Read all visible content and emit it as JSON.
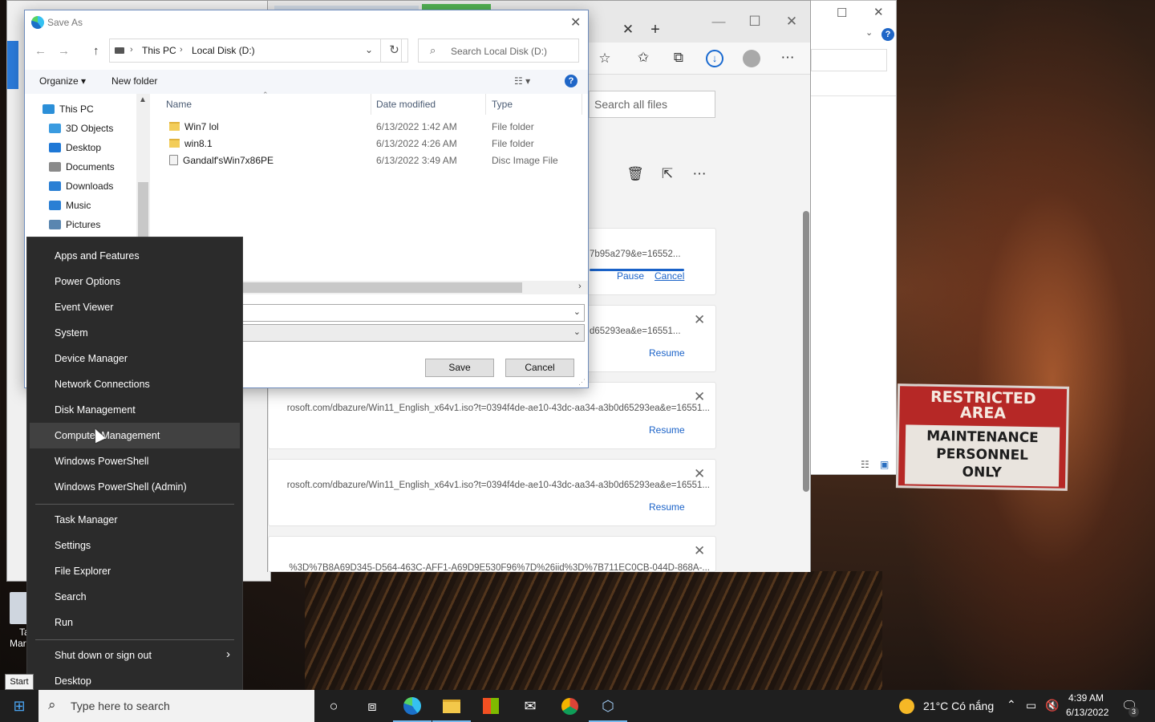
{
  "dialog": {
    "title": "Save As",
    "breadcrumb": [
      "This PC",
      "Local Disk (D:)"
    ],
    "search_placeholder": "Search Local Disk (D:)",
    "organize_label": "Organize",
    "new_folder_label": "New folder",
    "nav_items": [
      {
        "label": "This PC",
        "icon": "pc-icon",
        "color": "#2b8fd8"
      },
      {
        "label": "3D Objects",
        "icon": "cube-icon",
        "color": "#3a9be0"
      },
      {
        "label": "Desktop",
        "icon": "desktop-icon",
        "color": "#1e78d6"
      },
      {
        "label": "Documents",
        "icon": "document-icon",
        "color": "#8a8a8a"
      },
      {
        "label": "Downloads",
        "icon": "download-icon",
        "color": "#2a7fd4"
      },
      {
        "label": "Music",
        "icon": "music-icon",
        "color": "#2a7fd4"
      },
      {
        "label": "Pictures",
        "icon": "pictures-icon",
        "color": "#5a86b0"
      }
    ],
    "columns": [
      "Name",
      "Date modified",
      "Type"
    ],
    "files": [
      {
        "name": "Win7 lol",
        "date": "6/13/2022 1:42 AM",
        "type": "File folder",
        "kind": "folder"
      },
      {
        "name": "win8.1",
        "date": "6/13/2022 4:26 AM",
        "type": "File folder",
        "kind": "folder"
      },
      {
        "name": "Gandalf'sWin7x86PE",
        "date": "6/13/2022 3:49 AM",
        "type": "Disc Image File",
        "kind": "iso"
      }
    ],
    "save_label": "Save",
    "cancel_label": "Cancel"
  },
  "context_menu": {
    "group1": [
      "Apps and Features",
      "Power Options",
      "Event Viewer",
      "System",
      "Device Manager",
      "Network Connections",
      "Disk Management",
      "Computer Management",
      "Windows PowerShell",
      "Windows PowerShell (Admin)"
    ],
    "group2": [
      "Task Manager",
      "Settings",
      "File Explorer",
      "Search",
      "Run"
    ],
    "group3": [
      "Shut down or sign out",
      "Desktop"
    ],
    "hovered": "Computer Management"
  },
  "edge": {
    "search_all_files_placeholder": "Search all files",
    "downloads": [
      {
        "url": "7b95a279&e=16552...",
        "actions": [
          "Pause",
          "Cancel"
        ]
      },
      {
        "url": "d65293ea&e=16551...",
        "actions": [
          "Resume"
        ]
      },
      {
        "url": "rosoft.com/dbazure/Win11_English_x64v1.iso?t=0394f4de-ae10-43dc-aa34-a3b0d65293ea&e=16551...",
        "actions": [
          "Resume"
        ]
      },
      {
        "url": "rosoft.com/dbazure/Win11_English_x64v1.iso?t=0394f4de-ae10-43dc-aa34-a3b0d65293ea&e=16551...",
        "actions": [
          "Resume"
        ]
      },
      {
        "url": "%3D%7B8A69D345-D564-463C-AFF1-A69D9E530F96%7D%26iid%3D%7B711EC0CB-044D-868A-...",
        "actions": []
      }
    ]
  },
  "wallpaper_sign": {
    "top": [
      "RESTRICTED",
      "AREA"
    ],
    "bottom": [
      "MAINTENANCE",
      "PERSONNEL",
      "ONLY"
    ]
  },
  "taskbar": {
    "start_tooltip": "Start",
    "search_placeholder": "Type here to search",
    "weather": "21°C  Có nắng",
    "time": "4:39 AM",
    "date": "6/13/2022",
    "notification_count": "3"
  },
  "desktop_icon_fragments": [
    "Ta",
    "Mar"
  ]
}
